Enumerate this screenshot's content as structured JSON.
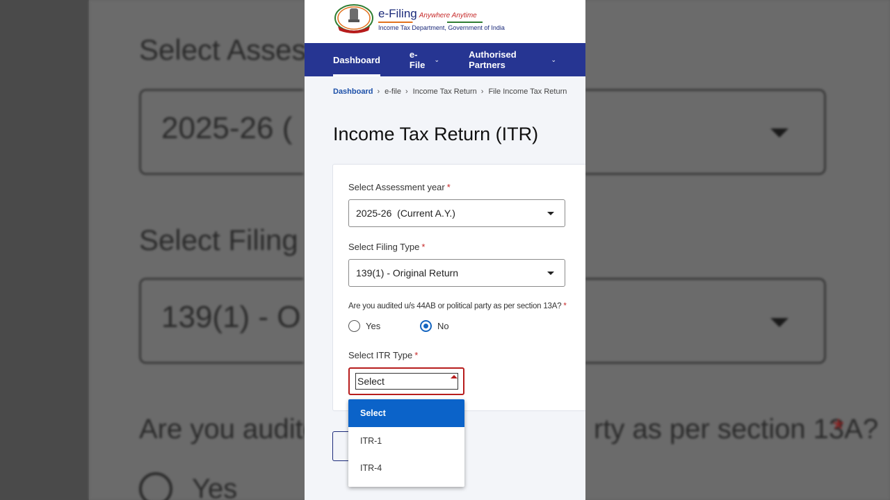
{
  "header": {
    "brand": "e-Filing",
    "tagline": "Anywhere Anytime",
    "subtitle": "Income Tax Department, Government of India"
  },
  "nav": {
    "items": [
      {
        "label": "Dashboard",
        "active": true,
        "has_dropdown": false
      },
      {
        "label": "e-File",
        "active": false,
        "has_dropdown": true
      },
      {
        "label": "Authorised Partners",
        "active": false,
        "has_dropdown": true
      }
    ]
  },
  "breadcrumb": [
    "Dashboard",
    "e-file",
    "Income Tax Return",
    "File Income Tax Return"
  ],
  "page": {
    "title": "Income Tax Return (ITR)"
  },
  "form": {
    "assessment_year": {
      "label": "Select Assessment year",
      "value": "2025-26  (Current A.Y.)"
    },
    "filing_type": {
      "label": "Select Filing Type",
      "value": "139(1) - Original Return"
    },
    "audit_question": {
      "label": "Are you audited u/s 44AB or political party as per section 13A?",
      "options": [
        {
          "label": "Yes",
          "checked": false
        },
        {
          "label": "No",
          "checked": true
        }
      ]
    },
    "itr_type": {
      "label": "Select ITR Type",
      "value": "Select",
      "options": [
        {
          "label": "Select",
          "selected": true
        },
        {
          "label": "ITR-1",
          "selected": false
        },
        {
          "label": "ITR-4",
          "selected": false
        }
      ]
    },
    "required_mark": "*"
  },
  "backdrop": {
    "assessment_label": "Select Asses",
    "assessment_value": "2025-26  (",
    "filing_label": "Select Filing",
    "filing_value": "139(1) - O",
    "question_left": "Are you audite",
    "question_right": "rty as per section 13A?",
    "radio_label": "Yes"
  },
  "colors": {
    "nav_bg": "#263592",
    "accent_blue": "#0b63c9",
    "required_red": "#c62828",
    "error_border": "#b71c1c"
  }
}
